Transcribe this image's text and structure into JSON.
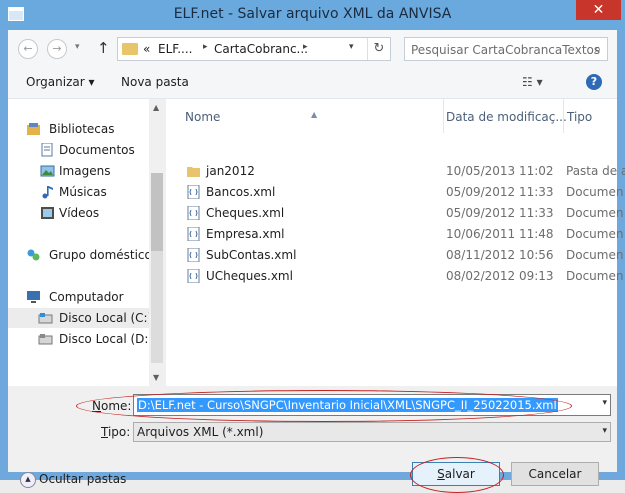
{
  "window": {
    "title": "ELF.net - Salvar arquivo XML da ANVISA",
    "close_glyph": "✕"
  },
  "navbar": {
    "back_glyph": "←",
    "forward_glyph": "→",
    "up_glyph": "↑",
    "breadcrumb": [
      "«",
      "ELF....",
      "CartaCobranc..."
    ],
    "refresh_glyph": "↻",
    "search_placeholder": "Pesquisar CartaCobrancaTextos"
  },
  "toolbar": {
    "organize_label": "Organizar ▾",
    "new_folder_label": "Nova pasta",
    "view_glyph": "☷ ▾",
    "help_glyph": "?"
  },
  "nav_pane": {
    "items": [
      {
        "label": "Bibliotecas",
        "icon": "library-icon"
      },
      {
        "label": "Documentos",
        "icon": "document-icon"
      },
      {
        "label": "Imagens",
        "icon": "image-icon"
      },
      {
        "label": "Músicas",
        "icon": "music-icon"
      },
      {
        "label": "Vídeos",
        "icon": "video-icon"
      },
      {
        "label": "Grupo doméstico",
        "icon": "homegroup-icon"
      },
      {
        "label": "Computador",
        "icon": "computer-icon"
      },
      {
        "label": "Disco Local (C:)",
        "icon": "drive-icon"
      },
      {
        "label": "Disco Local (D:)",
        "icon": "drive-icon"
      }
    ]
  },
  "file_list": {
    "columns": [
      "Nome",
      "Data de modificaç...",
      "Tipo"
    ],
    "rows": [
      {
        "name": "jan2012",
        "date": "10/05/2013 11:02",
        "type": "Pasta de a",
        "icon": "folder-icon"
      },
      {
        "name": "Bancos.xml",
        "date": "05/09/2012 11:33",
        "type": "Documen",
        "icon": "xml-file-icon"
      },
      {
        "name": "Cheques.xml",
        "date": "05/09/2012 11:33",
        "type": "Documen",
        "icon": "xml-file-icon"
      },
      {
        "name": "Empresa.xml",
        "date": "10/06/2011 11:48",
        "type": "Documen",
        "icon": "xml-file-icon"
      },
      {
        "name": "SubContas.xml",
        "date": "08/11/2012 10:56",
        "type": "Documen",
        "icon": "xml-file-icon"
      },
      {
        "name": "UCheques.xml",
        "date": "08/02/2012 09:13",
        "type": "Documen",
        "icon": "xml-file-icon"
      }
    ]
  },
  "footer": {
    "filename_label_u": "N",
    "filename_label_rest": "ome:",
    "filename_value": "D:\\ELF.net - Curso\\SNGPC\\Inventario Inicial\\XML\\SNGPC_II_25022015.xml",
    "type_label_u": "T",
    "type_label_rest": "ipo:",
    "type_value": "Arquivos XML (*.xml)",
    "hide_folders_label": "Ocultar pastas",
    "save_label_u": "S",
    "save_label_rest": "alvar",
    "cancel_label": "Cancelar"
  },
  "colors": {
    "frame": "#6aa9dd",
    "close": "#c7352b",
    "selection": "#3399ff",
    "annotation": "#c62020"
  }
}
